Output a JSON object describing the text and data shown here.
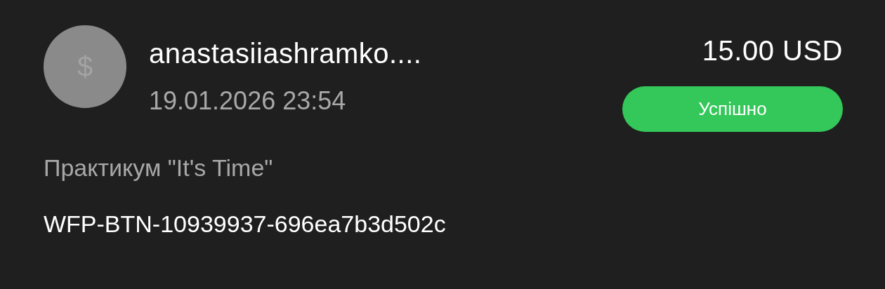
{
  "transaction": {
    "avatar_glyph": "$",
    "name": "anastasiiashramko....",
    "date": "19.01.2026 23:54",
    "amount": "15.00 USD",
    "status": "Успішно",
    "description": "Практикум \"It's Time\"",
    "reference": "WFP-BTN-10939937-696ea7b3d502c"
  }
}
